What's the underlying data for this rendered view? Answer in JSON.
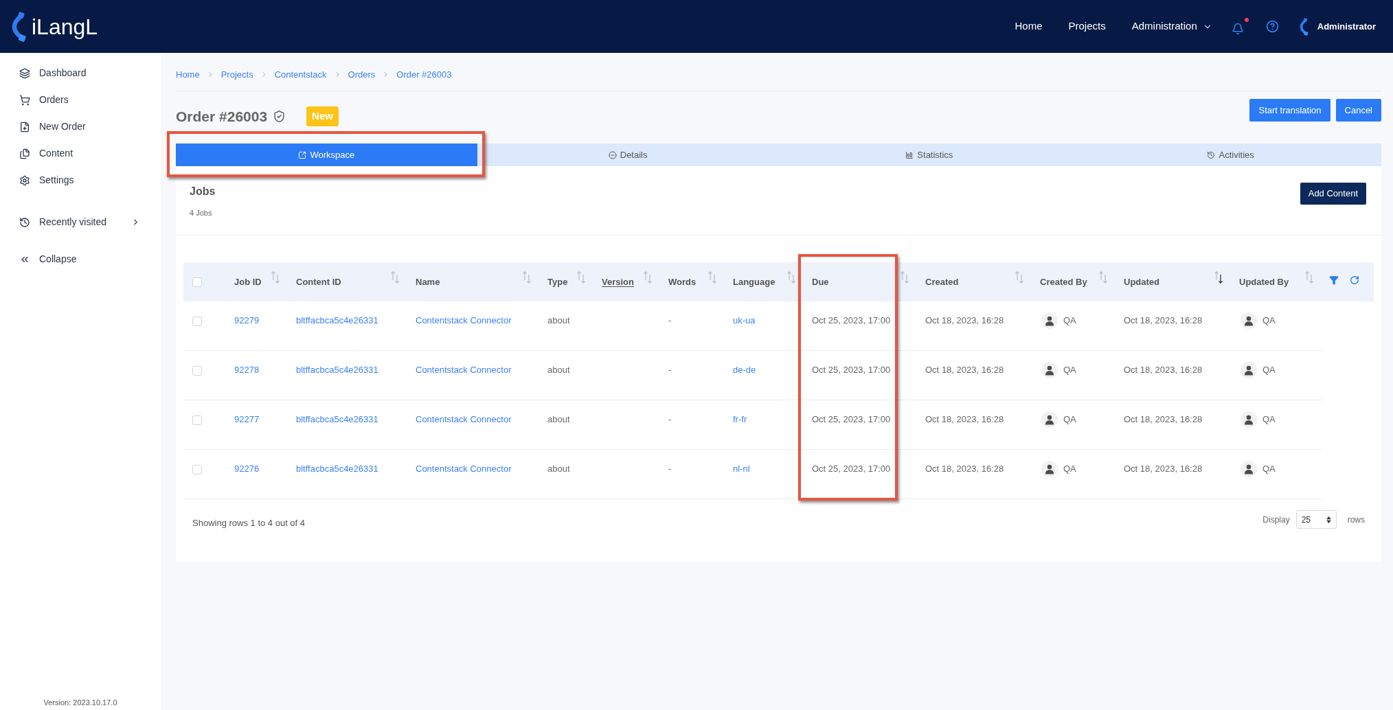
{
  "header": {
    "logo_text": "iLangL",
    "nav": [
      {
        "label": "Home",
        "kind": "link"
      },
      {
        "label": "Projects",
        "kind": "link"
      },
      {
        "label": "Administration",
        "kind": "dropdown"
      }
    ],
    "notifications": {
      "unread": true
    },
    "user": {
      "name": "Administrator"
    }
  },
  "sidebar": {
    "items": [
      {
        "label": "Dashboard",
        "kind": "link"
      },
      {
        "label": "Orders",
        "kind": "link"
      },
      {
        "label": "New Order",
        "kind": "link"
      },
      {
        "label": "Content",
        "kind": "link"
      },
      {
        "label": "Settings",
        "kind": "link"
      },
      {
        "label": "Recently visited",
        "kind": "submenu"
      },
      {
        "label": "Collapse",
        "kind": "collapse"
      }
    ],
    "version": "Version: 2023.10.17.0"
  },
  "breadcrumb": [
    "Home",
    "Projects",
    "Contentstack",
    "Orders",
    "Order #26003"
  ],
  "order": {
    "title": "Order #26003",
    "verified": true,
    "status": "New",
    "actions": [
      "Start translation",
      "Cancel"
    ]
  },
  "tabs": [
    {
      "label": "Workspace",
      "selected": true,
      "highlighted": true
    },
    {
      "label": "Details",
      "selected": false,
      "highlighted": false
    },
    {
      "label": "Statistics",
      "selected": false,
      "highlighted": false
    },
    {
      "label": "Activities",
      "selected": false,
      "highlighted": false
    }
  ],
  "jobs": {
    "title": "Jobs",
    "count": "4 Jobs",
    "add_button": "Add Content"
  },
  "table": {
    "select_all": {
      "checked": false
    },
    "columns": [
      {
        "label": "Job ID",
        "kind": "link",
        "sorted": false,
        "underlined": false,
        "highlighted": false
      },
      {
        "label": "Content ID",
        "kind": "link",
        "sorted": false,
        "underlined": false,
        "highlighted": false
      },
      {
        "label": "Name",
        "kind": "link",
        "sorted": false,
        "underlined": false,
        "highlighted": false
      },
      {
        "label": "Type",
        "kind": "text",
        "sorted": false,
        "underlined": false,
        "highlighted": false
      },
      {
        "label": "Version",
        "sorted": false,
        "underlined": true,
        "highlighted": false
      },
      {
        "label": "Words",
        "kind": "text",
        "sorted": false,
        "underlined": false,
        "highlighted": false
      },
      {
        "label": "Language",
        "kind": "link",
        "sorted": false,
        "underlined": false,
        "highlighted": false
      },
      {
        "label": "Due",
        "kind": "text",
        "sorted": false,
        "underlined": false,
        "highlighted": true
      },
      {
        "label": "Created",
        "kind": "text",
        "sorted": false,
        "underlined": false,
        "highlighted": false
      },
      {
        "label": "Created By",
        "kind": "user",
        "sorted": false,
        "underlined": false,
        "highlighted": false
      },
      {
        "label": "Updated",
        "kind": "text",
        "sorted": true,
        "underlined": false,
        "highlighted": false
      },
      {
        "label": "Updated By",
        "kind": "user",
        "sorted": false,
        "underlined": false,
        "highlighted": false
      }
    ],
    "rows": [
      {
        "checked": false,
        "job_id": "92279",
        "content_id": "bltffacbca5c4e26331",
        "name": "Contentstack Connector",
        "type": "about",
        "words": "-",
        "language": "uk-ua",
        "due": "Oct 25, 2023, 17:00",
        "created": "Oct 18, 2023, 16:28",
        "created_by": "QA",
        "updated": "Oct 18, 2023, 16:28",
        "updated_by": "QA"
      },
      {
        "checked": false,
        "job_id": "92278",
        "content_id": "bltffacbca5c4e26331",
        "name": "Contentstack Connector",
        "type": "about",
        "words": "-",
        "language": "de-de",
        "due": "Oct 25, 2023, 17:00",
        "created": "Oct 18, 2023, 16:28",
        "created_by": "QA",
        "updated": "Oct 18, 2023, 16:28",
        "updated_by": "QA"
      },
      {
        "checked": false,
        "job_id": "92277",
        "content_id": "bltffacbca5c4e26331",
        "name": "Contentstack Connector",
        "type": "about",
        "words": "-",
        "language": "fr-fr",
        "due": "Oct 25, 2023, 17:00",
        "created": "Oct 18, 2023, 16:28",
        "created_by": "QA",
        "updated": "Oct 18, 2023, 16:28",
        "updated_by": "QA"
      },
      {
        "checked": false,
        "job_id": "92276",
        "content_id": "bltffacbca5c4e26331",
        "name": "Contentstack Connector",
        "type": "about",
        "words": "-",
        "language": "nl-nl",
        "due": "Oct 25, 2023, 17:00",
        "created": "Oct 18, 2023, 16:28",
        "created_by": "QA",
        "updated": "Oct 18, 2023, 16:28",
        "updated_by": "QA"
      }
    ]
  },
  "footer": {
    "summary": "Showing rows 1 to 4 out of 4",
    "display_label": "Display",
    "page_size": "25",
    "rows_label": "rows"
  }
}
